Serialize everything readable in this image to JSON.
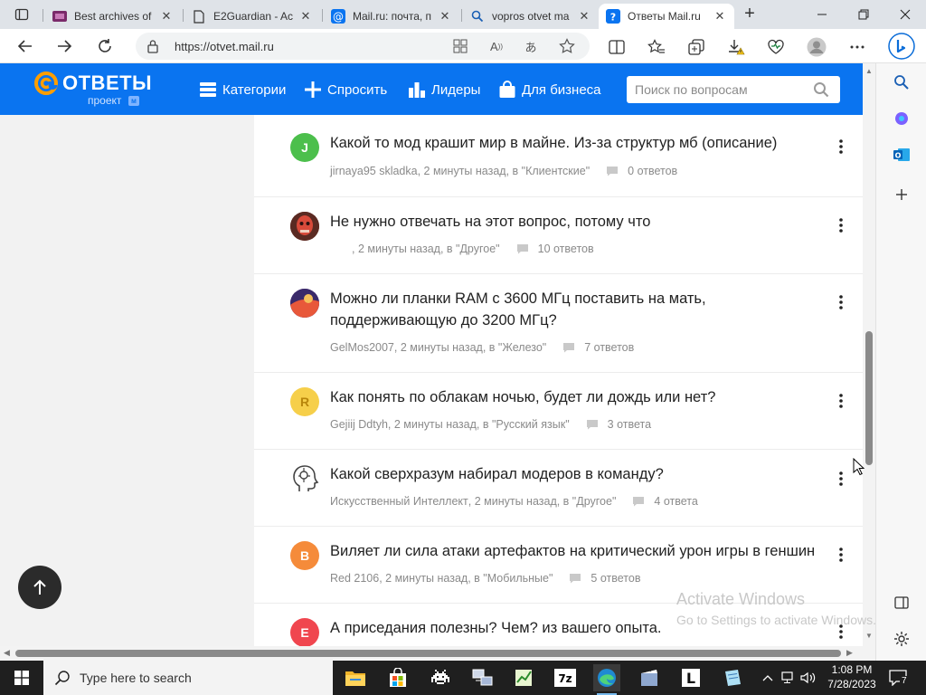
{
  "browser": {
    "tabs": [
      {
        "title": "Best archives of",
        "active": false
      },
      {
        "title": "E2Guardian - Ac",
        "active": false
      },
      {
        "title": "Mail.ru: почта, п",
        "active": false
      },
      {
        "title": "vopros otvet ma",
        "active": false
      },
      {
        "title": "Ответы Mail.ru",
        "active": true
      }
    ],
    "url": "https://otvet.mail.ru"
  },
  "site": {
    "logo": "ОТВЕТЫ",
    "logo_sub": "проект",
    "logo_badge": "м",
    "nav": {
      "categories": "Категории",
      "ask": "Спросить",
      "leaders": "Лидеры",
      "business": "Для бизнеса"
    },
    "search_placeholder": "Поиск по вопросам",
    "accent": "#0a74f0"
  },
  "questions": [
    {
      "avatar_letter": "J",
      "avatar_color": "#4cbf4c",
      "title": "Какой то мод крашит мир в майне. Из-за структур мб (описание)",
      "author": "jirnaya95 skladka",
      "meta": ", 2 минуты назад, в \"Клиентские\"",
      "answers": "0 ответов"
    },
    {
      "avatar_letter": "",
      "avatar_color": "#8a3a2a",
      "title": "Не нужно отвечать на этот вопрос, потому что",
      "author": "",
      "meta": ", 2 минуты назад, в \"Другое\"",
      "answers": "10 ответов"
    },
    {
      "avatar_letter": "",
      "avatar_color": "#7b3fa0",
      "title": "Можно ли планки RAM с 3600 МГц поставить на мать, поддерживающую до 3200 МГц?",
      "author": "GelMos2007",
      "meta": ", 2 минуты назад, в \"Железо\"",
      "answers": "7 ответов"
    },
    {
      "avatar_letter": "R",
      "avatar_color": "#f6cf4a",
      "title": "Как понять по облакам ночью, будет ли дождь или нет?",
      "author": "Gejiij Ddtyh",
      "meta": ", 2 минуты назад, в \"Русский язык\"",
      "answers": "3 ответа"
    },
    {
      "avatar_letter": "",
      "avatar_color": "#ffffff",
      "title": "Какой сверхразум набирал модеров в команду?",
      "author": "Искусственный Интеллект",
      "meta": ", 2 минуты назад, в \"Другое\"",
      "answers": "4 ответа"
    },
    {
      "avatar_letter": "B",
      "avatar_color": "#f58b3a",
      "title": "Виляет ли сила атаки артефактов на критический урон игры в геншин",
      "author": "Red 2106",
      "meta": ", 2 минуты назад, в \"Мобильные\"",
      "answers": "5 ответов"
    },
    {
      "avatar_letter": "E",
      "avatar_color": "#f0464f",
      "title": "А приседания полезны? Чем? из вашего опыта.",
      "author": "",
      "meta": "",
      "answers": ""
    }
  ],
  "watermark": {
    "title": "Activate Windows",
    "subtitle": "Go to Settings to activate Windows."
  },
  "taskbar": {
    "search_placeholder": "Type here to search",
    "time": "1:08 PM",
    "date": "7/28/2023",
    "notification_count": "7"
  }
}
